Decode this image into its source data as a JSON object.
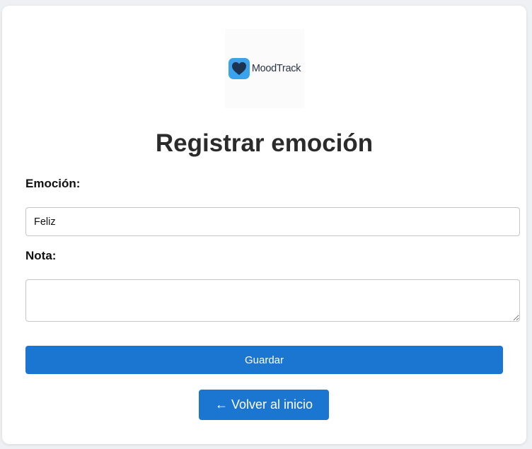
{
  "logo": {
    "text": "MoodTrack",
    "icon": "heart-icon",
    "accent": "#3aa3ee"
  },
  "page": {
    "title": "Registrar emoción"
  },
  "form": {
    "emotion_label": "Emoción:",
    "emotion_value": "Feliz",
    "note_label": "Nota:",
    "note_value": "",
    "save_label": "Guardar"
  },
  "nav": {
    "back_label": "← Volver al inicio"
  },
  "colors": {
    "primary": "#1b76d2",
    "title": "#2b2b2b",
    "border": "#c6c6c6"
  }
}
